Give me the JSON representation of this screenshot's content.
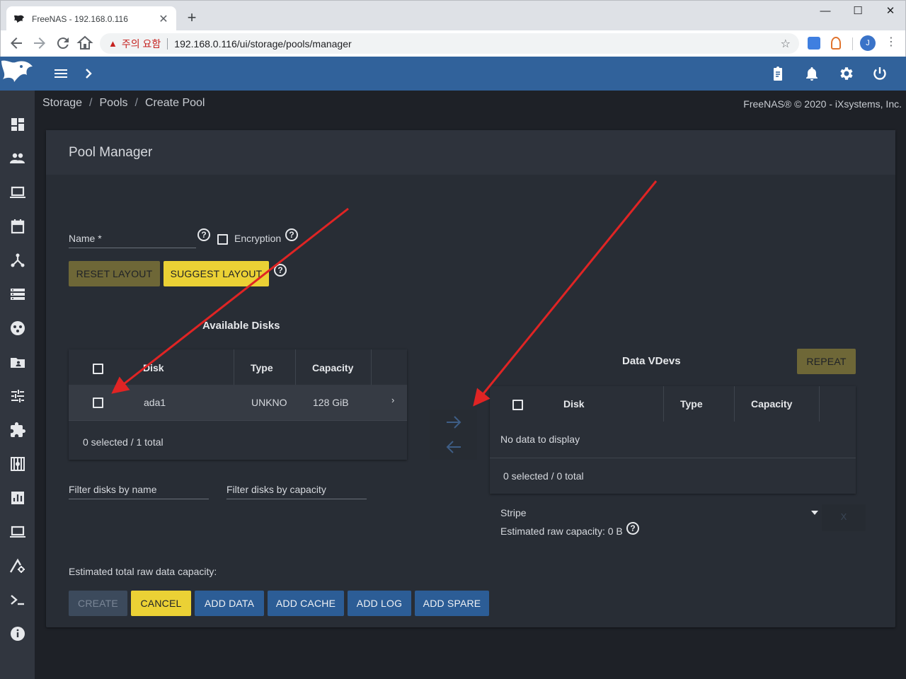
{
  "browser": {
    "tab_title": "FreeNAS - 192.168.0.116",
    "tab_close": "✕",
    "new_tab": "+",
    "security_warning": "주의 요함",
    "url": "192.168.0.116/ui/storage/pools/manager",
    "profile_initial": "J",
    "icons": [
      "back-icon",
      "forward-icon",
      "reload-icon",
      "home-icon",
      "warning-icon",
      "star-icon",
      "menu-icon"
    ]
  },
  "app": {
    "brand_color": "#31629b",
    "breadcrumb": [
      "Storage",
      "Pools",
      "Create Pool"
    ],
    "copyright": "FreeNAS® © 2020 - iXsystems, Inc.",
    "sidebar_icons": [
      "dashboard-icon",
      "accounts-icon",
      "system-icon",
      "tasks-icon",
      "network-icon",
      "storage-icon",
      "directory-services-icon",
      "sharing-icon",
      "services-icon",
      "plugins-icon",
      "jails-icon",
      "reporting-icon",
      "virtual-machines-icon",
      "display-system-processes-icon",
      "shell-icon",
      "guide-icon"
    ]
  },
  "pool_manager": {
    "title": "Pool Manager",
    "name_label": "Name *",
    "encryption_label": "Encryption",
    "reset_layout": "RESET LAYOUT",
    "suggest_layout": "SUGGEST LAYOUT",
    "available_disks": {
      "title": "Available Disks",
      "columns": [
        "Disk",
        "Type",
        "Capacity"
      ],
      "rows": [
        {
          "disk": "ada1",
          "type": "UNKNO",
          "capacity": "128 GiB"
        }
      ],
      "footer": "0 selected / 1 total",
      "filter_name": "Filter disks by name",
      "filter_capacity": "Filter disks by capacity"
    },
    "data_vdevs": {
      "title": "Data VDevs",
      "repeat": "REPEAT",
      "columns": [
        "Disk",
        "Type",
        "Capacity"
      ],
      "empty": "No data to display",
      "footer": "0 selected / 0 total",
      "layout": "Stripe",
      "estimated_raw": "Estimated raw capacity: 0 B",
      "remove": "X"
    },
    "estimated_total": "Estimated total raw data capacity:",
    "buttons": {
      "create": "CREATE",
      "cancel": "CANCEL",
      "add_data": "ADD DATA",
      "add_cache": "ADD CACHE",
      "add_log": "ADD LOG",
      "add_spare": "ADD SPARE"
    }
  },
  "annotation_color": "#e02424"
}
